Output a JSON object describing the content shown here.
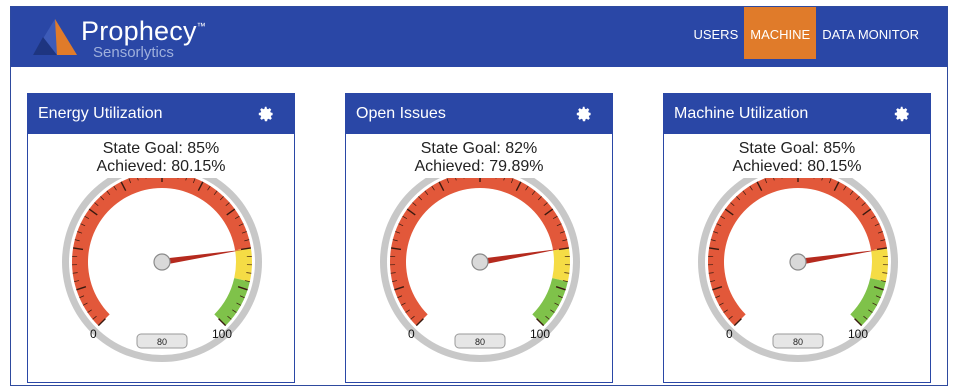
{
  "header": {
    "brand_name": "Prophecy",
    "trademark": "™",
    "tagline": "Sensorlytics",
    "nav": [
      {
        "label": "USERS",
        "active": false
      },
      {
        "label": "MACHINE",
        "active": true
      },
      {
        "label": "DATA MONITOR",
        "active": false
      }
    ]
  },
  "colors": {
    "header_bg": "#2a47a6",
    "active_tab": "#e07b2a",
    "gauge_red": "#e2583a",
    "gauge_yellow": "#f5dc45",
    "gauge_green": "#7fc24a",
    "needle": "#b52a1e"
  },
  "cards": [
    {
      "title": "Energy Utilization",
      "icon": "gear-icon",
      "goal_text": "State Goal: 85%",
      "achieved_text": "Achieved: 80.15%",
      "gauge": {
        "min_label": "0",
        "max_label": "100",
        "readout": "80",
        "value": 80.15
      }
    },
    {
      "title": "Open Issues",
      "icon": "gear-icon",
      "goal_text": "State Goal: 82%",
      "achieved_text": "Achieved: 79.89%",
      "gauge": {
        "min_label": "0",
        "max_label": "100",
        "readout": "80",
        "value": 79.89
      }
    },
    {
      "title": "Machine Utilization",
      "icon": "gear-icon",
      "goal_text": "State Goal: 85%",
      "achieved_text": "Achieved: 80.15%",
      "gauge": {
        "min_label": "0",
        "max_label": "100",
        "readout": "80",
        "value": 80.15
      }
    }
  ]
}
